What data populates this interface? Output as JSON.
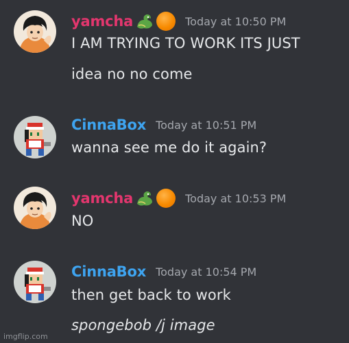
{
  "colors": {
    "background": "#313338",
    "yamcha_name": "#e3366e",
    "cinnabox_name": "#3ea4f0",
    "timestamp": "#a5a8ae",
    "text": "#e6e8ea"
  },
  "messages": [
    {
      "author": "yamcha",
      "author_icons": [
        "dragon-emoji-icon",
        "orange-circle-icon"
      ],
      "timestamp": "Today at 10:50 PM",
      "lines": [
        "I AM TRYING TO WORK ITS JUST",
        "idea no no come"
      ]
    },
    {
      "author": "CinnaBox",
      "timestamp": "Today at 10:51 PM",
      "lines": [
        "wanna see me do it again?"
      ]
    },
    {
      "author": "yamcha",
      "author_icons": [
        "dragon-emoji-icon",
        "orange-circle-icon"
      ],
      "timestamp": "Today at 10:53 PM",
      "lines": [
        "NO"
      ]
    },
    {
      "author": "CinnaBox",
      "timestamp": "Today at 10:54 PM",
      "lines": [
        "then get back to work",
        "spongebob /j image"
      ]
    }
  ],
  "watermark": "imgflip.com"
}
